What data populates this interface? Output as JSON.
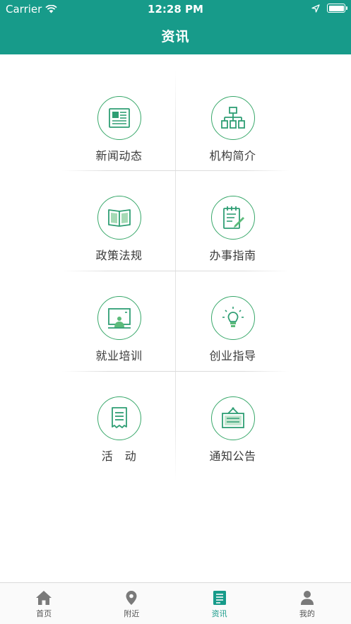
{
  "status_bar": {
    "carrier": "Carrier",
    "time": "12:28 PM"
  },
  "header": {
    "title": "资讯"
  },
  "menu": {
    "items": [
      {
        "label": "新闻动态",
        "icon": "newspaper-icon"
      },
      {
        "label": "机构简介",
        "icon": "org-chart-icon"
      },
      {
        "label": "政策法规",
        "icon": "book-icon"
      },
      {
        "label": "办事指南",
        "icon": "notepad-pen-icon"
      },
      {
        "label": "就业培训",
        "icon": "training-board-icon"
      },
      {
        "label": "创业指导",
        "icon": "lightbulb-icon"
      },
      {
        "label": "活　动",
        "icon": "receipt-icon"
      },
      {
        "label": "通知公告",
        "icon": "notice-board-icon"
      }
    ]
  },
  "tabbar": {
    "tabs": [
      {
        "label": "首页",
        "icon": "home-icon"
      },
      {
        "label": "附近",
        "icon": "location-pin-icon"
      },
      {
        "label": "资讯",
        "icon": "news-icon",
        "active": true
      },
      {
        "label": "我的",
        "icon": "user-icon"
      }
    ]
  },
  "colors": {
    "brand": "#179b8a",
    "icon_green": "#38a86a"
  }
}
